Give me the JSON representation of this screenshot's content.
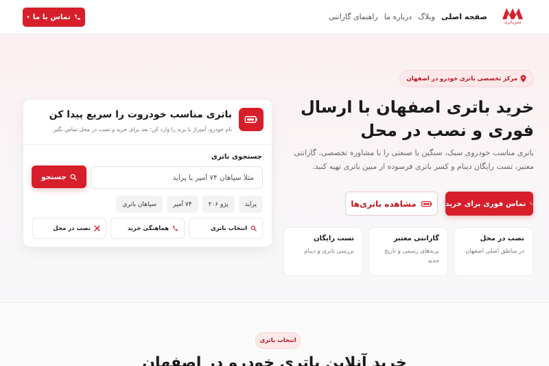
{
  "header": {
    "logo_text": "مبین‌باتری",
    "nav": [
      "صفحه اصلی",
      "وبلاگ",
      "درباره ما",
      "راهنمای گارانتی"
    ],
    "cta_label": "تماس با ما"
  },
  "hero": {
    "badge": "مرکز تخصصی باتری خودرو در اصفهان",
    "title": "خرید باتری اصفهان با ارسال فوری و نصب در محل",
    "description": "باتری مناسب خودروی سبک، سنگین یا صنعتی را با مشاوره تخصصی، گارانتی معتبر، تست رایگان دینام و کسر باتری فرسوده از مبین باتری تهیه کنید.",
    "btn_primary": "تماس فوری برای خرید",
    "btn_secondary": "مشاهده باتری‌ها",
    "features": [
      {
        "title": "نصب در محل",
        "desc": "در مناطق اصلی اصفهان"
      },
      {
        "title": "گارانتی معتبر",
        "desc": "برندهای رسمی و تاریخ جدید"
      },
      {
        "title": "تست رایگان",
        "desc": "بررسی باتری و دینام"
      }
    ]
  },
  "search_card": {
    "title": "باتری مناسب خودروت را سریع پیدا کن",
    "subtitle": "نام خودرو، آمپراژ یا برند را وارد کن؛ بعد برای خرید و نصب در محل تماس بگیر.",
    "search_label": "جستجوی باتری",
    "search_placeholder": "مثلاً سپاهان ۷۴ آمپر یا پراید",
    "search_button": "جستجو",
    "chips": [
      "پراید",
      "پژو ۲۰۶",
      "۷۴ آمپر",
      "سپاهان باتری"
    ],
    "actions": [
      "انتخاب باتری",
      "هماهنگی خرید",
      "نصب در محل"
    ]
  },
  "section": {
    "badge": "انتخاب باتری",
    "title": "خرید آنلاین باتری خودرو در اصفهان"
  },
  "colors": {
    "brand": "#d71f2b",
    "badge_bg": "#fde8ea"
  }
}
